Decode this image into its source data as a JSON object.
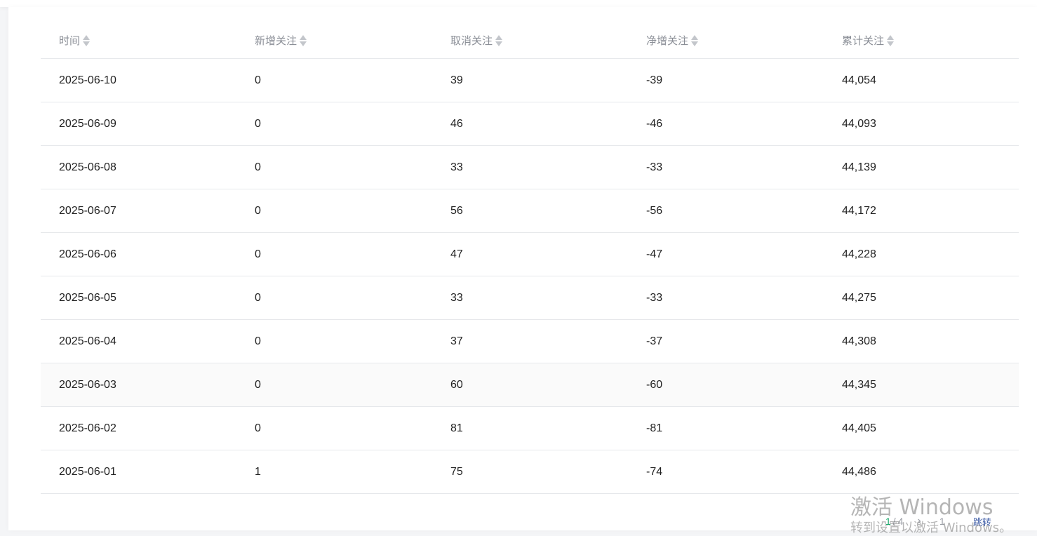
{
  "table": {
    "columns": [
      {
        "label": "时间"
      },
      {
        "label": "新增关注"
      },
      {
        "label": "取消关注"
      },
      {
        "label": "净增关注"
      },
      {
        "label": "累计关注"
      }
    ],
    "rows": [
      {
        "date": "2025-06-10",
        "new": "0",
        "cancel": "39",
        "net": "-39",
        "total": "44,054"
      },
      {
        "date": "2025-06-09",
        "new": "0",
        "cancel": "46",
        "net": "-46",
        "total": "44,093"
      },
      {
        "date": "2025-06-08",
        "new": "0",
        "cancel": "33",
        "net": "-33",
        "total": "44,139"
      },
      {
        "date": "2025-06-07",
        "new": "0",
        "cancel": "56",
        "net": "-56",
        "total": "44,172"
      },
      {
        "date": "2025-06-06",
        "new": "0",
        "cancel": "47",
        "net": "-47",
        "total": "44,228"
      },
      {
        "date": "2025-06-05",
        "new": "0",
        "cancel": "33",
        "net": "-33",
        "total": "44,275"
      },
      {
        "date": "2025-06-04",
        "new": "0",
        "cancel": "37",
        "net": "-37",
        "total": "44,308"
      },
      {
        "date": "2025-06-03",
        "new": "0",
        "cancel": "60",
        "net": "-60",
        "total": "44,345"
      },
      {
        "date": "2025-06-02",
        "new": "0",
        "cancel": "81",
        "net": "-81",
        "total": "44,405"
      },
      {
        "date": "2025-06-01",
        "new": "1",
        "cancel": "75",
        "net": "-74",
        "total": "44,486"
      }
    ]
  },
  "pagination": {
    "current": "1",
    "separator": "/",
    "total": "4",
    "next_icon": "chevron-right-icon",
    "jump_value": "1",
    "jump_label": "跳转",
    "accent_color": "#19a96b"
  },
  "watermark": {
    "title": "激活 Windows",
    "subtitle": "转到设置以激活 Windows。"
  }
}
